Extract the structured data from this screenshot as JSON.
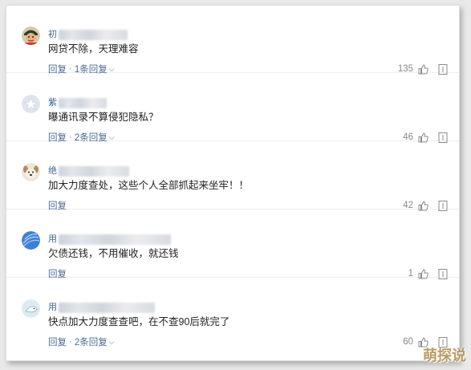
{
  "comments": [
    {
      "username_visible": "初",
      "text": "网贷不除，天理难容",
      "reply_label": "回复",
      "sep": "·",
      "replies_label": "1条回复",
      "has_replies": true,
      "likes": "135",
      "avatar_icon": "cartoon-character-avatar"
    },
    {
      "username_visible": "紫",
      "text": "曝通讯录不算侵犯隐私？",
      "reply_label": "回复",
      "sep": "·",
      "replies_label": "2条回复",
      "has_replies": true,
      "likes": "46",
      "avatar_icon": "star-avatar"
    },
    {
      "username_visible": "绝",
      "text": "加大力度查处，这些个人全部抓起来坐牢！！",
      "reply_label": "回复",
      "sep": "",
      "replies_label": "",
      "has_replies": false,
      "likes": "42",
      "avatar_icon": "dog-avatar"
    },
    {
      "username_visible": "用",
      "text": "欠债还钱，不用催收，就还钱",
      "reply_label": "回复",
      "sep": "",
      "replies_label": "",
      "has_replies": false,
      "likes": "1",
      "avatar_icon": "blue-planet-avatar"
    },
    {
      "username_visible": "用",
      "text": "快点加大力度查查吧，在不查90后就完了",
      "reply_label": "回复",
      "sep": "·",
      "replies_label": "2条回复",
      "has_replies": true,
      "likes": "60",
      "avatar_icon": "bird-avatar"
    }
  ],
  "watermark": "萌探说",
  "colors": {
    "link": "#4a6b94",
    "text": "#222222",
    "username": "#406599",
    "count": "#888888"
  }
}
